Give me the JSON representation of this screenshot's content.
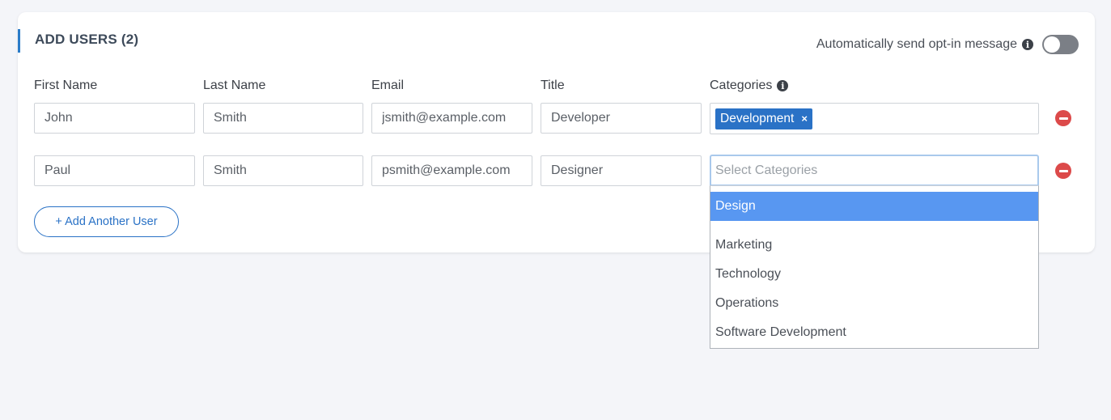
{
  "card": {
    "title": "ADD USERS (2)",
    "optin_label": "Automatically send opt-in message",
    "optin_enabled": false
  },
  "columns": {
    "first_name": "First Name",
    "last_name": "Last Name",
    "email": "Email",
    "title": "Title",
    "categories": "Categories"
  },
  "users": [
    {
      "first_name": "John",
      "last_name": "Smith",
      "email": "jsmith@example.com",
      "title": "Developer",
      "categories": [
        "Development"
      ]
    },
    {
      "first_name": "Paul",
      "last_name": "Smith",
      "email": "psmith@example.com",
      "title": "Designer",
      "categories_placeholder": "Select Categories"
    }
  ],
  "tag_remove_symbol": "×",
  "add_button_label": "+ Add Another User",
  "dropdown": {
    "options": [
      "Design",
      "Marketing",
      "Technology",
      "Operations",
      "Software Development"
    ],
    "highlighted": "Design"
  },
  "colors": {
    "accent": "#2a72c6",
    "danger": "#dc4a4a",
    "highlight": "#5897f1",
    "toggle_off": "#7b7f86"
  },
  "icons": {
    "info": "info-icon",
    "remove": "minus-circle-icon",
    "tag_remove": "close-icon"
  }
}
